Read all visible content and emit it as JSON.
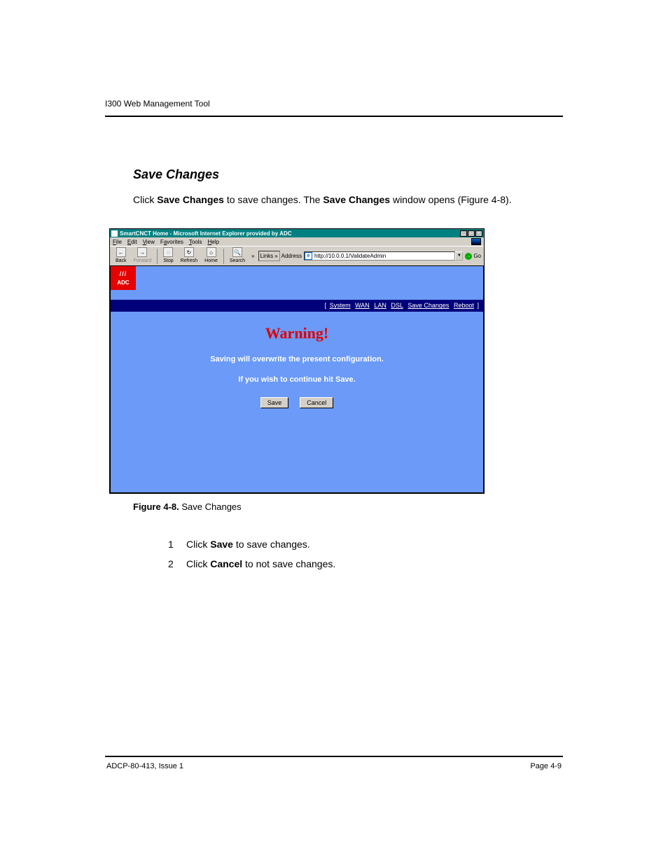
{
  "header_running": "I300 Web Management Tool",
  "section_title": "Save Changes",
  "intro_text_parts": {
    "prefix": "Click ",
    "bold1": "Save Changes",
    "mid1": " to save changes. The ",
    "bold2": "Save Changes",
    "mid2": " window opens (",
    "figref": "Figure 4-8",
    "suffix": ")."
  },
  "window": {
    "title": "SmartCNCT Home - Microsoft Internet Explorer provided by ADC",
    "menu": {
      "file": "File",
      "edit": "Edit",
      "view": "View",
      "favorites": "Favorites",
      "tools": "Tools",
      "help": "Help"
    },
    "toolbar": {
      "back": "Back",
      "forward": "Forward",
      "stop": "Stop",
      "refresh": "Refresh",
      "home": "Home",
      "search": "Search"
    },
    "links_label": "Links",
    "address_label": "Address",
    "address_value": "http://10.0.0.1/ValidateAdmin",
    "go_label": "Go",
    "logo": {
      "stripes": "///",
      "text": "ADC"
    },
    "nav": {
      "system": "System",
      "wan": "WAN",
      "lan": "LAN",
      "dsl": "DSL",
      "save": "Save Changes",
      "reboot": "Reboot"
    },
    "warning_title": "Warning!",
    "warning_line1": "Saving will overwrite the present configuration.",
    "warning_line2": "If you wish to continue hit Save.",
    "buttons": {
      "save": "Save",
      "cancel": "Cancel"
    }
  },
  "figure_caption": {
    "label": "Figure 4-8.",
    "text": "Save Changes"
  },
  "actions": {
    "num1": "1",
    "click": "Click ",
    "save_bold": "Save",
    "save_tail": " to save changes.",
    "num2": "2",
    "cancel_bold": "Cancel",
    "cancel_tail": " to not save changes."
  },
  "footer": {
    "doc": "ADCP-80-413, Issue 1",
    "page": "Page 4-9"
  }
}
